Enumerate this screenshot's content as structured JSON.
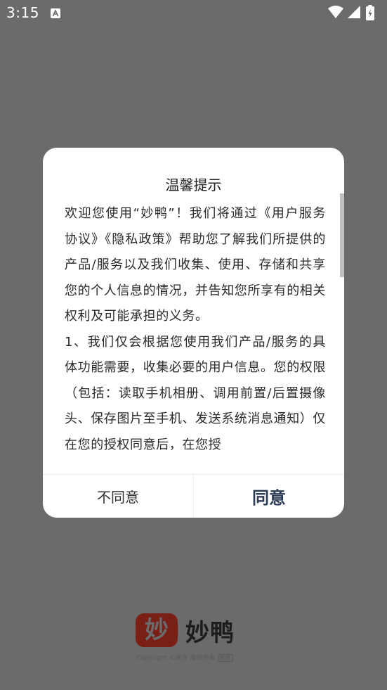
{
  "status_bar": {
    "time": "3:15"
  },
  "dialog": {
    "title": "温馨提示",
    "paragraphs": [
      "欢迎您使用“妙鸭”！我们将通过《用户服务协议》《隐私政策》帮助您了解我们所提供的产品/服务以及我们收集、使用、存储和共享您的个人信息的情况，并告知您所享有的相关权利及可能承担的义务。",
      "1、我们仅会根据您使用我们产品/服务的具体功能需要，收集必要的用户信息。您的权限（包括：读取手机相册、调用前置/后置摄像头、保存图片至手机、发送系统消息通知）仅在您的授权同意后，在您授"
    ],
    "disagree_label": "不同意",
    "agree_label": "同意"
  },
  "splash": {
    "logo_glyph": "妙",
    "brand_name": "妙鸭",
    "copyright": "Copyright ©未序 版权所有",
    "copyright_tag": "新版"
  },
  "colors": {
    "overlay": "#6b6b6b",
    "agree_text": "#2b3a55",
    "logo_bg": "#7a1f16"
  }
}
